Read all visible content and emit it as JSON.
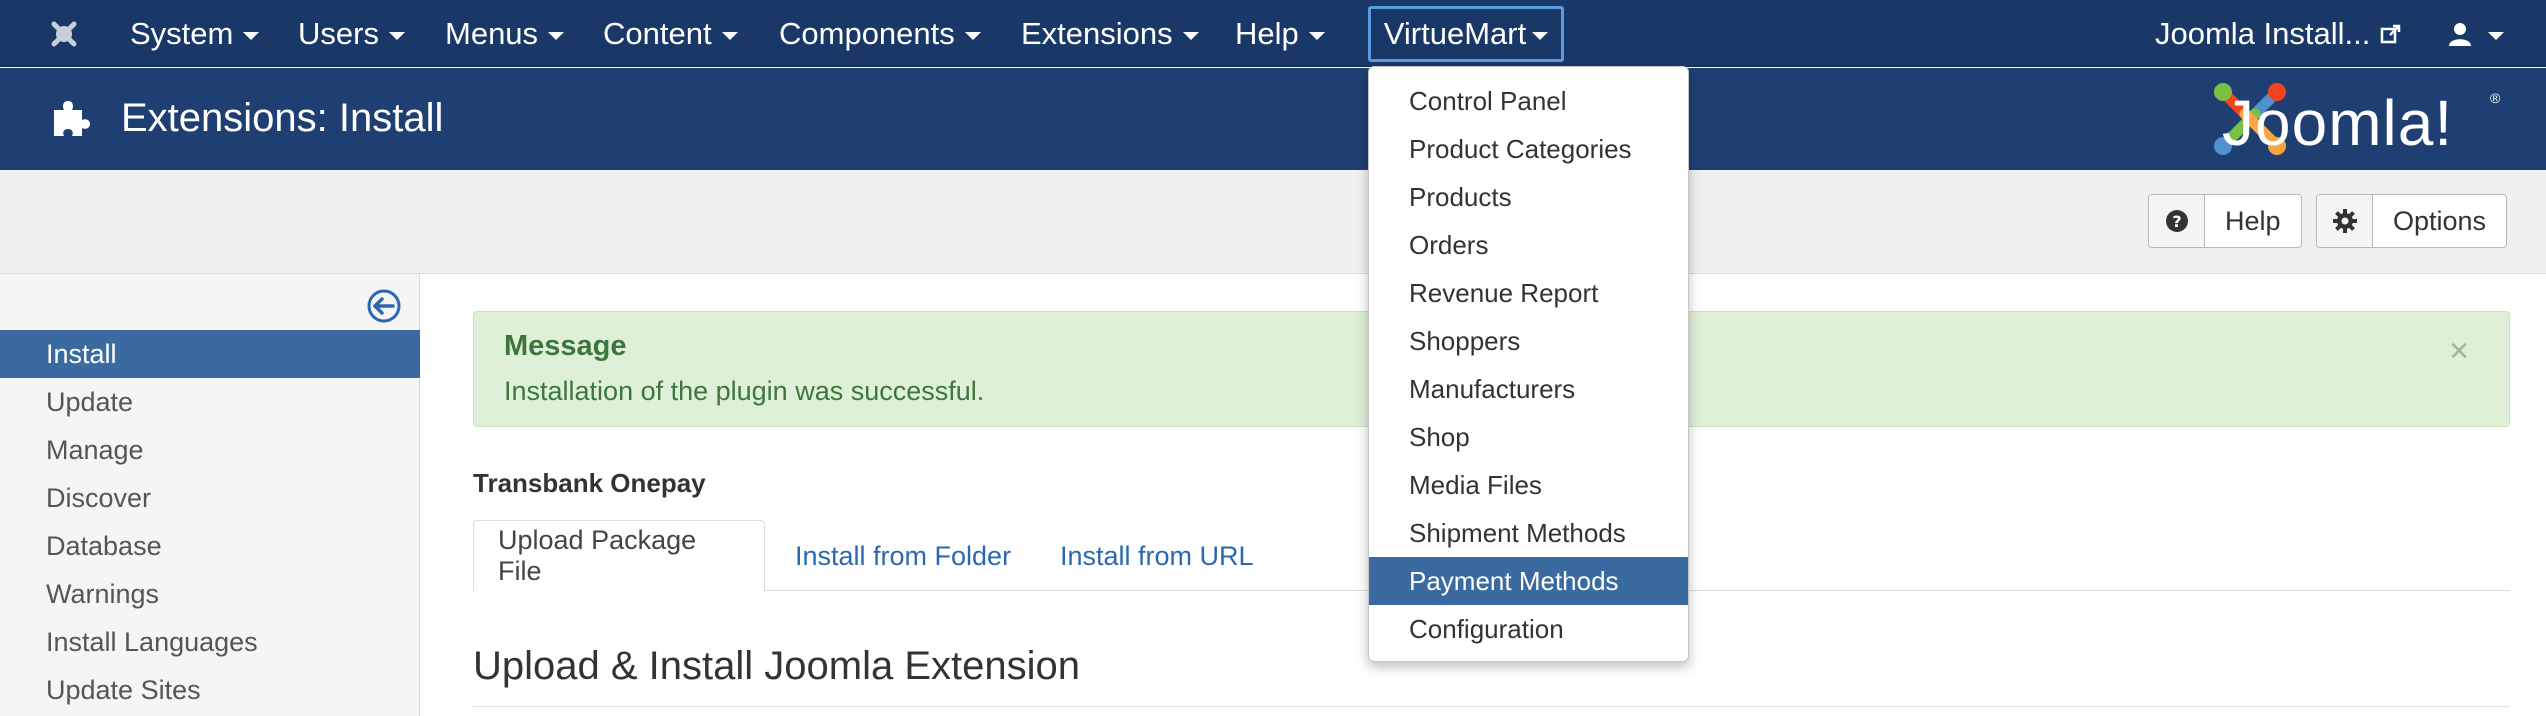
{
  "topnav": {
    "items": [
      {
        "label": "System"
      },
      {
        "label": "Users"
      },
      {
        "label": "Menus"
      },
      {
        "label": "Content"
      },
      {
        "label": "Components"
      },
      {
        "label": "Extensions"
      },
      {
        "label": "Help"
      }
    ],
    "open_menu": "VirtueMart",
    "site_link": "Joomla Install..."
  },
  "header": {
    "title": "Extensions: Install",
    "logo_text": "Joomla!",
    "logo_reg": "®"
  },
  "toolbar": {
    "help_label": "Help",
    "options_label": "Options"
  },
  "sidebar": {
    "items": [
      {
        "label": "Install",
        "active": true
      },
      {
        "label": "Update"
      },
      {
        "label": "Manage"
      },
      {
        "label": "Discover"
      },
      {
        "label": "Database"
      },
      {
        "label": "Warnings"
      },
      {
        "label": "Install Languages"
      },
      {
        "label": "Update Sites"
      }
    ]
  },
  "alert": {
    "title": "Message",
    "text": "Installation of the plugin was successful.",
    "close": "×"
  },
  "main": {
    "plugin_name": "Transbank Onepay",
    "tabs": [
      {
        "label": "Upload Package File",
        "active": true
      },
      {
        "label": "Install from Folder"
      },
      {
        "label": "Install from URL"
      }
    ],
    "section_title": "Upload & Install Joomla Extension"
  },
  "dropdown": {
    "items": [
      {
        "label": "Control Panel"
      },
      {
        "label": "Product Categories"
      },
      {
        "label": "Products"
      },
      {
        "label": "Orders"
      },
      {
        "label": "Revenue Report"
      },
      {
        "label": "Shoppers"
      },
      {
        "label": "Manufacturers"
      },
      {
        "label": "Shop"
      },
      {
        "label": "Media Files"
      },
      {
        "label": "Shipment Methods"
      },
      {
        "label": "Payment Methods",
        "active": true
      },
      {
        "label": "Configuration"
      }
    ]
  },
  "colors": {
    "nav_bg": "#1a3867",
    "header_bg": "#1f3f73",
    "active_bg": "#3b6aa0",
    "alert_bg": "#dff0d8",
    "alert_text": "#3c763d",
    "link": "#2a69b0"
  },
  "icons": [
    "joomla-brand-icon",
    "puzzle-icon",
    "external-link-icon",
    "user-icon",
    "question-icon",
    "gear-icon",
    "collapse-left-icon",
    "close-icon"
  ]
}
